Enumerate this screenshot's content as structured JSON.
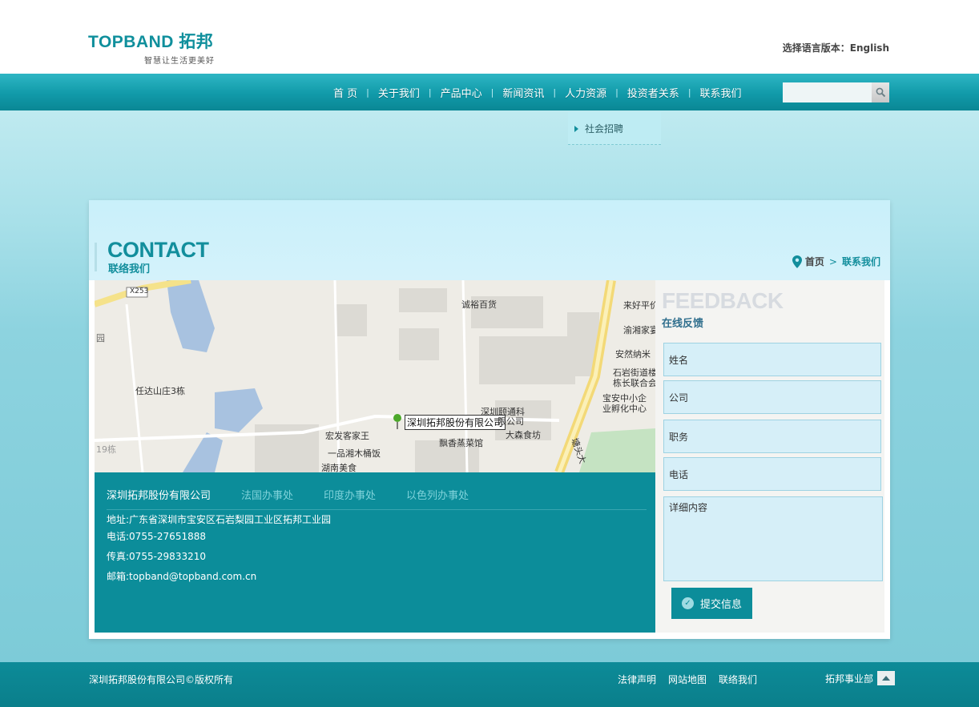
{
  "header": {
    "logo_main": "TOPBAND 拓邦",
    "logo_slogan": "智慧让生活更美好",
    "lang_label": "选择语言版本：",
    "lang_link": "English"
  },
  "nav": {
    "items": [
      "首 页",
      "关于我们",
      "产品中心",
      "新闻资讯",
      "人力资源",
      "投资者关系",
      "联系我们"
    ],
    "separator": "|"
  },
  "search": {
    "placeholder": ""
  },
  "dropdown": {
    "item": "社会招聘"
  },
  "page": {
    "title_en": "CONTACT",
    "title_cn": "联络我们",
    "breadcrumb": {
      "home": "首页",
      "sep": ">",
      "current": "联系我们"
    }
  },
  "map": {
    "pin_label": "深圳拓邦股份有限公司",
    "road_label": "X253",
    "pois": [
      "诚裕百货",
      "来好平价",
      "渝湘家宴",
      "安然纳米",
      "石岩街道楼",
      "栋长联合会",
      "宝安中小企",
      "业孵化中心",
      "任达山庄3栋",
      "深圳颐通科",
      "限公司",
      "宏发客家王",
      "大森食坊",
      "飘香蒸菜馆",
      "一品湘木桶饭",
      "湖南美食",
      "19栋",
      "园",
      "塘头大"
    ]
  },
  "info": {
    "tabs": [
      "深圳拓邦股份有限公司",
      "法国办事处",
      "印度办事处",
      "以色列办事处"
    ],
    "address": "地址:广东省深圳市宝安区石岩梨园工业区拓邦工业园",
    "phone": "电话:0755-27651888",
    "fax": "传真:0755-29833210",
    "email": "邮箱:topband@topband.com.cn"
  },
  "feedback": {
    "title_en": "FEEDBACK",
    "title_cn": "在线反馈",
    "fields": [
      "姓名",
      "公司",
      "职务",
      "电话"
    ],
    "textarea": "详细内容",
    "submit": "提交信息"
  },
  "footer": {
    "copyright": "深圳拓邦股份有限公司©版权所有",
    "links": [
      "法律声明",
      "网站地图",
      "联络我们"
    ],
    "division": "拓邦事业部"
  }
}
